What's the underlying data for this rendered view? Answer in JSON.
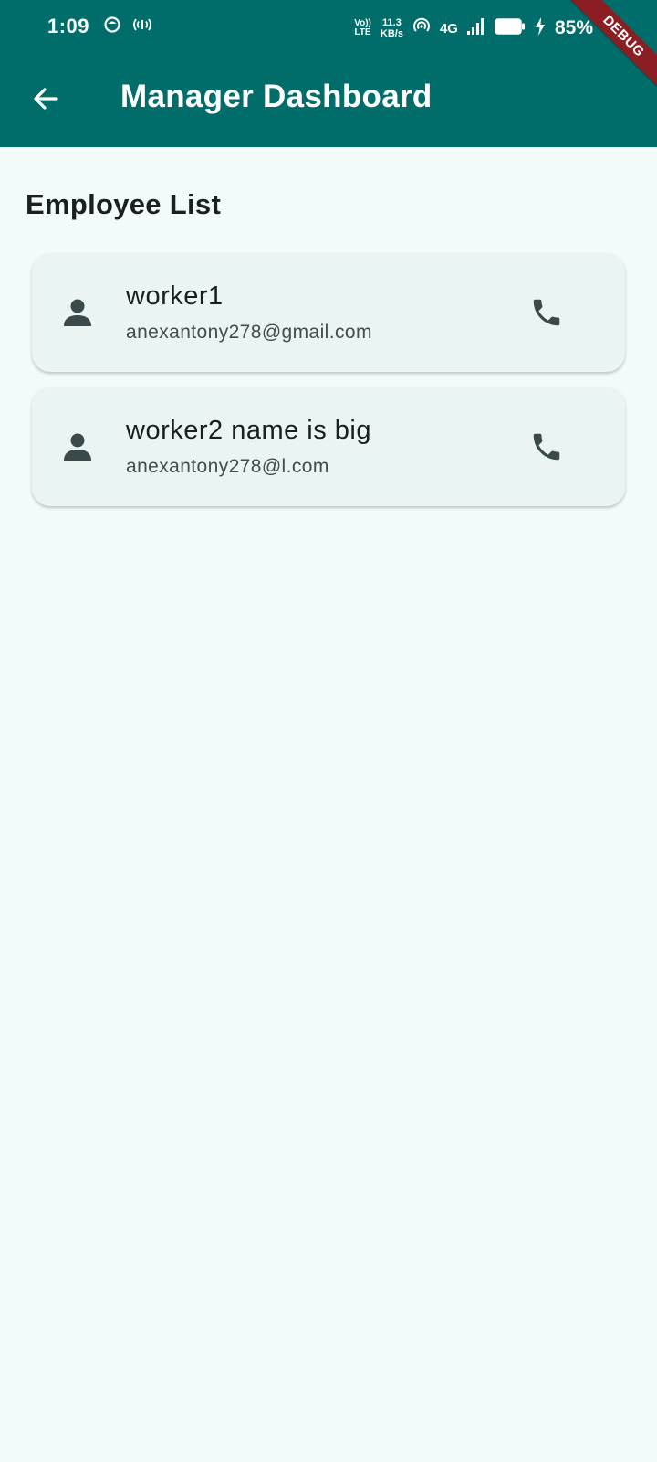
{
  "status_bar": {
    "time": "1:09",
    "volte_top": "Vo))",
    "volte_bottom": "LTE",
    "speed_value": "11.3",
    "speed_unit": "KB/s",
    "network": "4G",
    "battery_pct": "85%",
    "left_icons": [
      "app-notification-icon",
      "broadcast-icon"
    ],
    "right_icons": [
      "hotspot-icon",
      "signal-icon",
      "battery-icon",
      "charging-icon"
    ]
  },
  "debug_banner": "DEBUG",
  "app_bar": {
    "title": "Manager Dashboard",
    "back_icon": "arrow-back-icon",
    "color": "#006d6a"
  },
  "section": {
    "title": "Employee List"
  },
  "employees": [
    {
      "name": "worker1",
      "email": "anexantony278@gmail.com",
      "avatar_icon": "person-icon",
      "action_icon": "phone-icon"
    },
    {
      "name": "worker2 name is big",
      "email": "anexantony278@l.com",
      "avatar_icon": "person-icon",
      "action_icon": "phone-icon"
    }
  ],
  "colors": {
    "background": "#f2fbfa",
    "card": "#eaf4f3",
    "icon": "#3a4a4a",
    "debug": "#8b1e23"
  }
}
